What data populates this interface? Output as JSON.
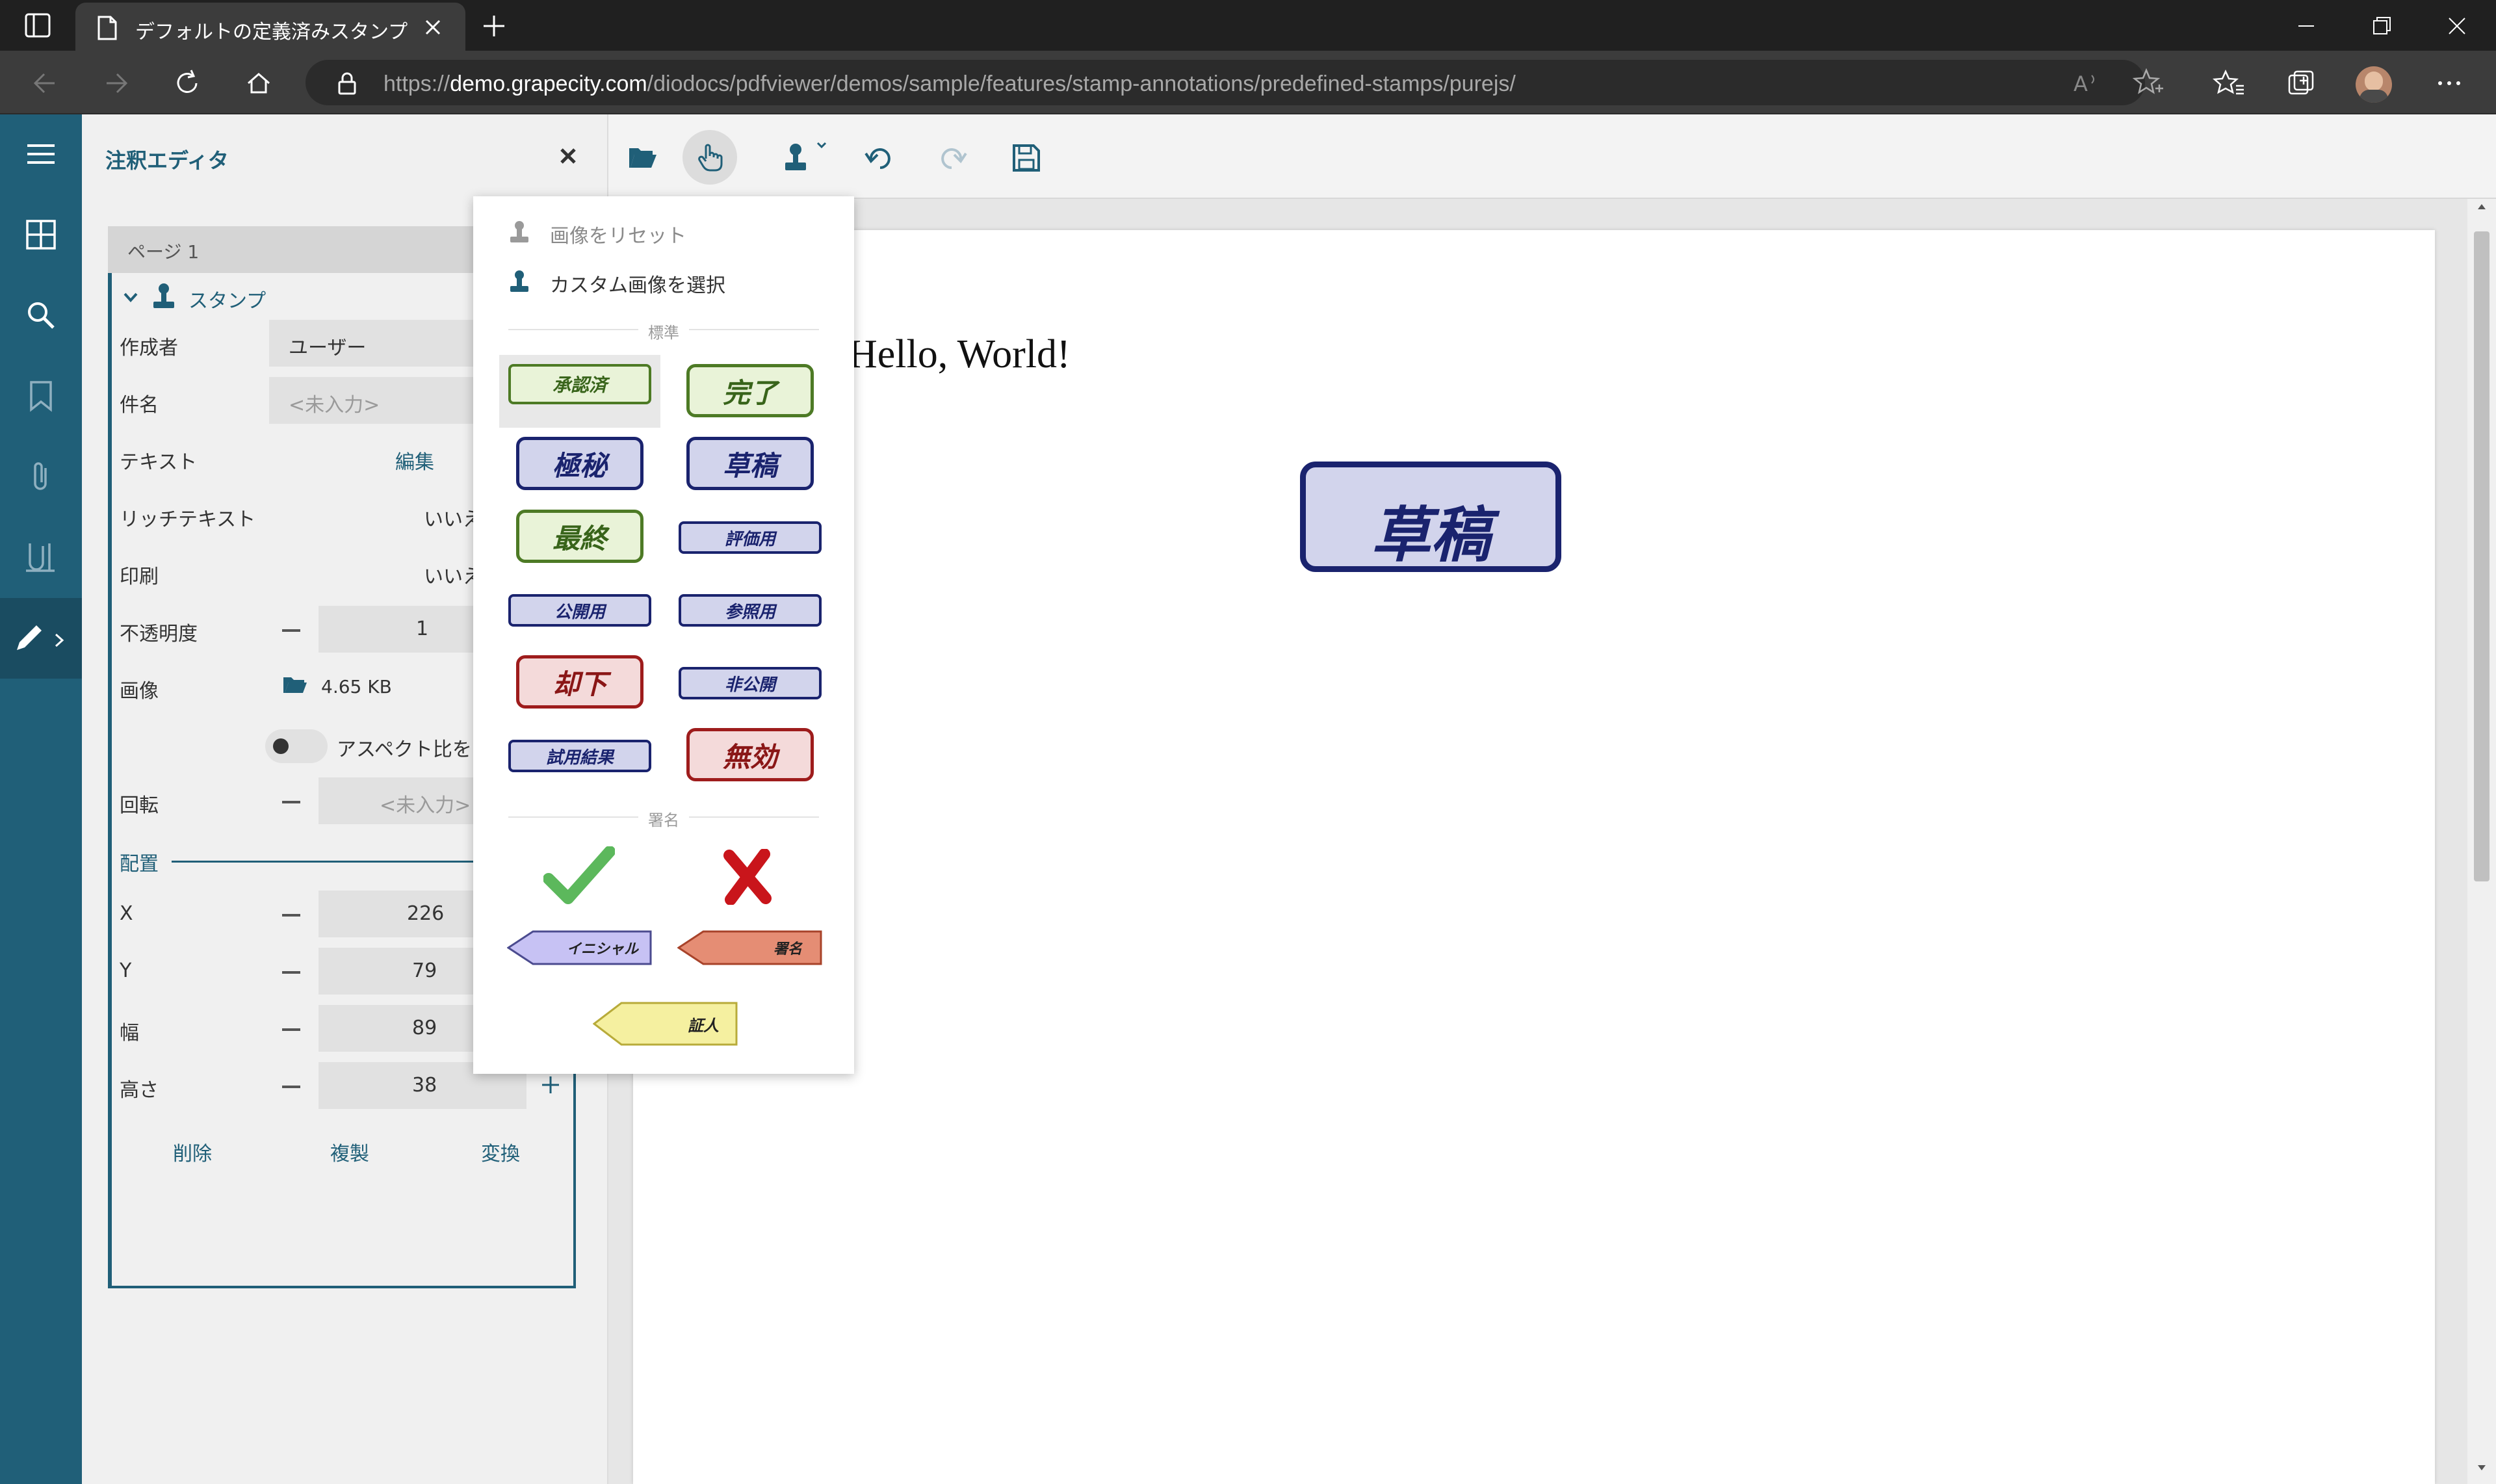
{
  "browser": {
    "tab_title": "デフォルトの定義済みスタンプ",
    "url_prefix": "https://",
    "url_host": "demo.grapecity.com",
    "url_path": "/diodocs/pdfviewer/demos/sample/features/stamp-annotations/predefined-stamps/purejs/"
  },
  "editor": {
    "title": "注釈エディタ",
    "page_header": "ページ 1",
    "group_label": "スタンプ",
    "author_label": "作成者",
    "author_value": "ユーザー",
    "subject_label": "件名",
    "subject_placeholder": "<未入力>",
    "text_label": "テキスト",
    "text_edit": "編集",
    "rich_text_label": "リッチテキスト",
    "rich_text_value": "いいえ",
    "print_label": "印刷",
    "print_value": "いいえ",
    "opacity_label": "不透明度",
    "opacity_value": "1",
    "image_label": "画像",
    "image_size": "4.65 KB",
    "aspect_label": "アスペクト比を",
    "rotation_label": "回転",
    "rotation_placeholder": "<未入力>",
    "layout_label": "配置",
    "x_label": "X",
    "x_value": "226",
    "y_label": "Y",
    "y_value": "79",
    "width_label": "幅",
    "width_value": "89",
    "height_label": "高さ",
    "height_value": "38",
    "delete": "削除",
    "duplicate": "複製",
    "convert": "変換"
  },
  "document": {
    "hello_text": "Hello, World!",
    "placed_stamp": "草稿"
  },
  "stamp_menu": {
    "reset_image": "画像をリセット",
    "select_custom": "カスタム画像を選択",
    "standard_section": "標準",
    "signature_section": "署名",
    "standard_stamps": [
      {
        "label": "承認済",
        "style": "green"
      },
      {
        "label": "完了",
        "style": "green"
      },
      {
        "label": "極秘",
        "style": "blue"
      },
      {
        "label": "草稿",
        "style": "blue"
      },
      {
        "label": "最終",
        "style": "green"
      },
      {
        "label": "評価用",
        "style": "blue"
      },
      {
        "label": "公開用",
        "style": "blue"
      },
      {
        "label": "参照用",
        "style": "blue"
      },
      {
        "label": "却下",
        "style": "red"
      },
      {
        "label": "非公開",
        "style": "blue"
      },
      {
        "label": "試用結果",
        "style": "blue"
      },
      {
        "label": "無効",
        "style": "red"
      }
    ],
    "signature_stamps": {
      "initials": "イニシャル",
      "sign": "署名",
      "witness": "証人"
    }
  },
  "colors": {
    "sidebar": "#205f78",
    "accent": "#205f78",
    "stamp_green": "#4d7a25",
    "stamp_blue": "#1a236e",
    "stamp_red": "#9e1c1c"
  }
}
